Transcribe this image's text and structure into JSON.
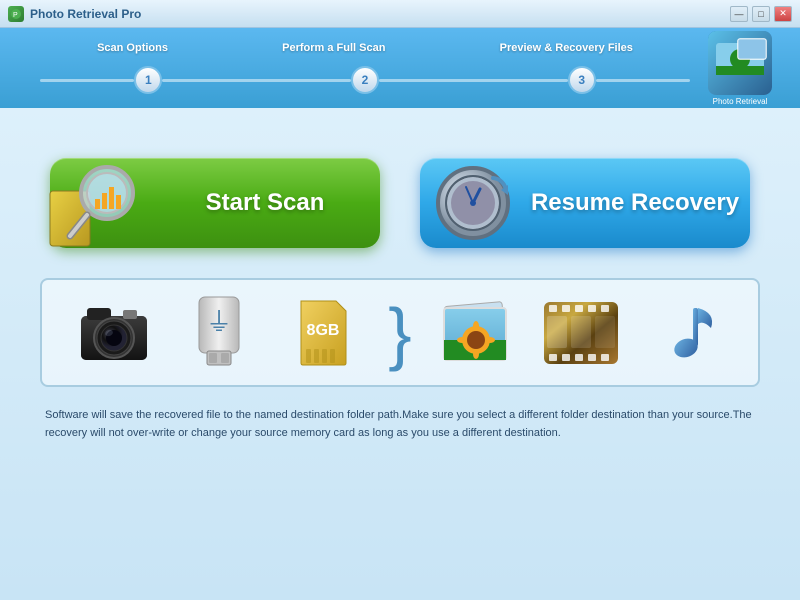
{
  "titleBar": {
    "title": "Photo Retrieval Pro",
    "controls": {
      "minimize": "—",
      "maximize": "□",
      "close": "✕"
    }
  },
  "wizard": {
    "steps": [
      {
        "number": "1",
        "label": "Scan Options"
      },
      {
        "number": "2",
        "label": "Perform a Full Scan"
      },
      {
        "number": "3",
        "label": "Preview & Recovery Files"
      }
    ],
    "logoLabel": "Photo\nRetrieval"
  },
  "buttons": {
    "startScan": "Start Scan",
    "resumeRecovery": "Resume Recovery"
  },
  "infoText": "Software will save the recovered file to the named destination folder path.Make sure you select a different folder destination than your source.The recovery will not over-write or change your source memory card as long as you use a different destination.",
  "icons": {
    "camera": "camera",
    "usb": "usb-drive",
    "sdCard": "SD Card",
    "sdLabel": "8GB",
    "photos": "photos",
    "film": "film",
    "music": "music"
  }
}
